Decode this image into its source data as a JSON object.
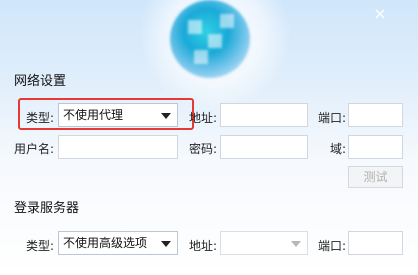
{
  "window": {
    "close_glyph": "×"
  },
  "network": {
    "title": "网络设置",
    "type_label": "类型:",
    "type_value": "不使用代理",
    "address_label": "地址:",
    "port_label": "端口:",
    "username_label": "用户名:",
    "password_label": "密码:",
    "domain_label": "域:",
    "test_button": "测试"
  },
  "login_server": {
    "title": "登录服务器",
    "type_label": "类型:",
    "type_value": "不使用高级选项",
    "address_label": "地址:",
    "port_label": "端口:"
  },
  "colors": {
    "highlight": "#e53935",
    "accent_bg": "#cfe6fb"
  },
  "icons": [
    "close-icon",
    "chevron-down-icon"
  ]
}
